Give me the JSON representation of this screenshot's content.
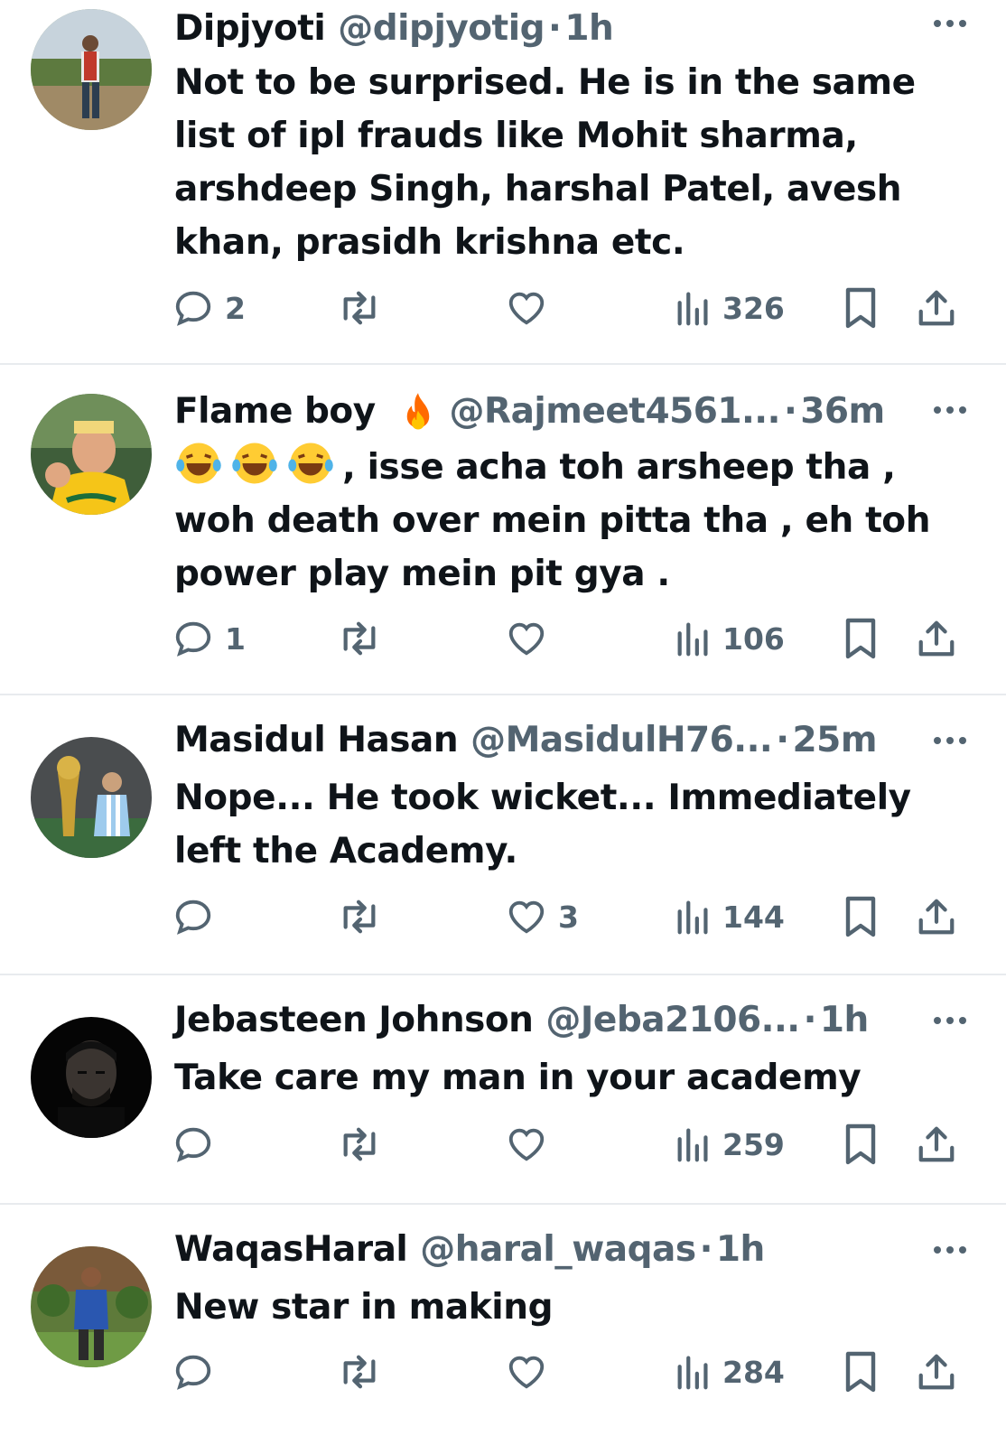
{
  "replies": [
    {
      "name": "Dipjyoti",
      "handle": "@dipjyotig",
      "dot": "·",
      "time": "1h",
      "has_fire": false,
      "emoji_count": 0,
      "lines": [
        "Not to be surprised. He is in the same",
        "list of ipl frauds like Mohit sharma,",
        "arshdeep Singh, harshal Patel, avesh",
        "khan, prasidh krishna etc."
      ],
      "reply_count": "2",
      "retweet_count": "",
      "like_count": "",
      "view_count": "326"
    },
    {
      "name": "Flame boy",
      "handle": "@Rajmeet4561...",
      "dot": "·",
      "time": "36m",
      "has_fire": true,
      "emoji_count": 3,
      "lines": [
        ", isse acha toh arsheep tha ,",
        "woh death over mein pitta tha , eh toh",
        "power play mein pit gya ."
      ],
      "reply_count": "1",
      "retweet_count": "",
      "like_count": "",
      "view_count": "106"
    },
    {
      "name": "Masidul Hasan",
      "handle": "@MasidulH76...",
      "dot": "·",
      "time": "25m",
      "has_fire": false,
      "emoji_count": 0,
      "lines": [
        "Nope... He took wicket... Immediately",
        "left the Academy."
      ],
      "reply_count": "",
      "retweet_count": "",
      "like_count": "3",
      "view_count": "144"
    },
    {
      "name": "Jebasteen Johnson",
      "handle": "@Jeba2106...",
      "dot": "·",
      "time": "1h",
      "has_fire": false,
      "emoji_count": 0,
      "lines": [
        "Take care my man in your academy"
      ],
      "reply_count": "",
      "retweet_count": "",
      "like_count": "",
      "view_count": "259"
    },
    {
      "name": "WaqasHaral",
      "handle": "@haral_waqas",
      "dot": "·",
      "time": "1h",
      "has_fire": false,
      "emoji_count": 0,
      "lines": [
        "New star in making"
      ],
      "reply_count": "",
      "retweet_count": "",
      "like_count": "",
      "view_count": "284"
    }
  ],
  "colors": {
    "text": "#0f1419",
    "secondary": "#536471",
    "divider": "#e8ebee",
    "fire": "#ff6a00",
    "emoji": "#ffcc33"
  },
  "icons": [
    "reply-icon",
    "retweet-icon",
    "like-icon",
    "views-icon",
    "bookmark-icon",
    "share-icon",
    "more-icon",
    "fire-icon",
    "laughing-emoji-icon"
  ]
}
